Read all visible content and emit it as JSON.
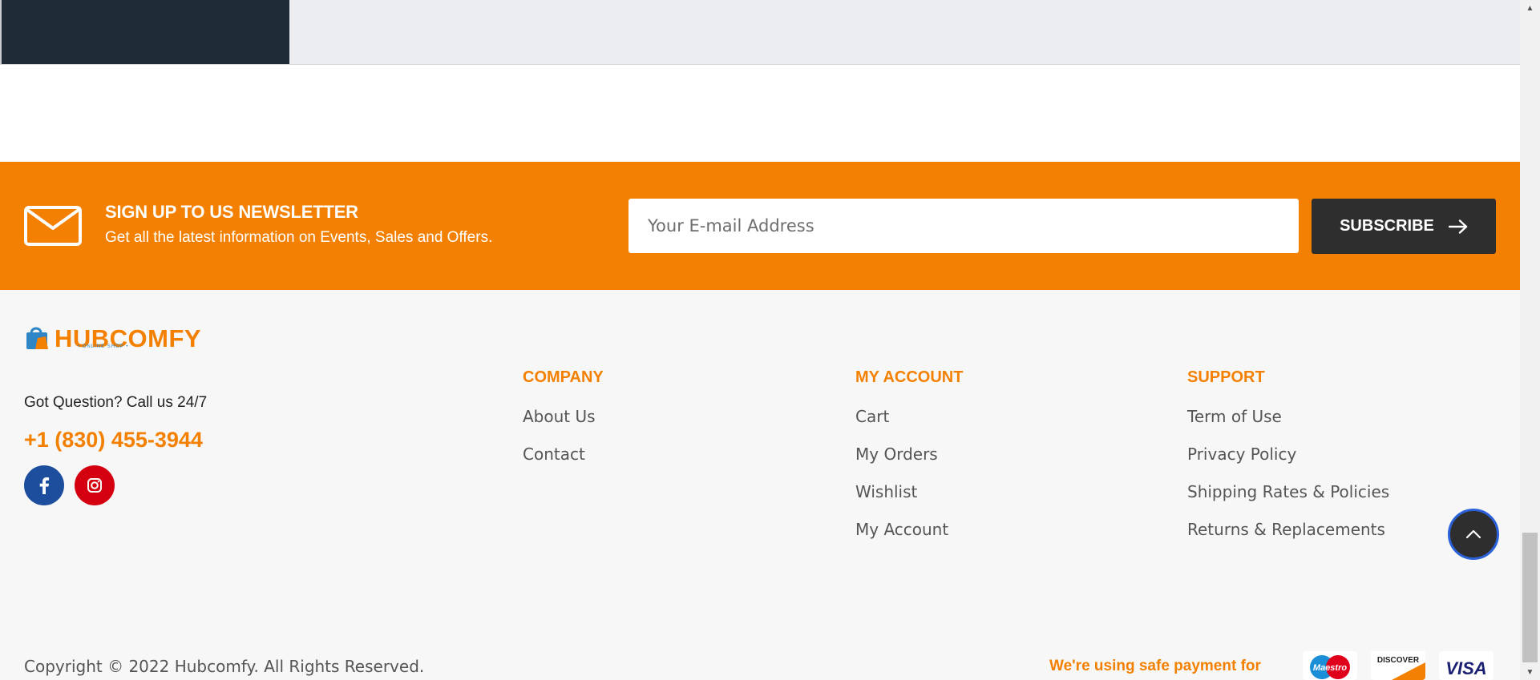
{
  "newsletter": {
    "title": "SIGN UP TO US NEWSLETTER",
    "subtitle": "Get all the latest information on Events, Sales and Offers.",
    "email_placeholder": "Your E-mail Address",
    "subscribe_label": "SUBSCRIBE",
    "icon": "mail-icon",
    "background_color": "#f38000",
    "button_color": "#2e2e2e"
  },
  "footer": {
    "logo_text": "HUBCOMFY",
    "logo_tagline": "• ONLINE SHOP •",
    "got_question": "Got Question? Call us 24/7",
    "phone": "+1 (830) 455-3944",
    "social": [
      {
        "name": "facebook",
        "icon": "facebook-icon",
        "color": "#1c4e9d"
      },
      {
        "name": "instagram",
        "icon": "instagram-icon",
        "color": "#d4000f"
      }
    ],
    "columns": {
      "company": {
        "title": "COMPANY",
        "links": [
          "About Us",
          "Contact"
        ]
      },
      "account": {
        "title": "MY ACCOUNT",
        "links": [
          "Cart",
          "My Orders",
          "Wishlist",
          "My Account"
        ]
      },
      "support": {
        "title": "SUPPORT",
        "links": [
          "Term of Use",
          "Privacy Policy",
          "Shipping Rates & Policies",
          "Returns & Replacements"
        ]
      }
    },
    "copyright": "Copyright © 2022 Hubcomfy. All Rights Reserved.",
    "safe_payment": "We're using safe payment for",
    "payment_cards": [
      {
        "name": "Maestro",
        "icon": "maestro-icon"
      },
      {
        "name": "DISCOVER",
        "icon": "discover-icon"
      },
      {
        "name": "VISA",
        "icon": "visa-icon"
      }
    ],
    "accent_color": "#f38000"
  },
  "back_to_top": {
    "icon": "chevron-up-icon"
  }
}
